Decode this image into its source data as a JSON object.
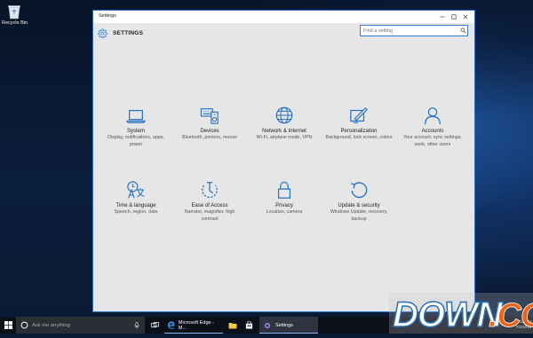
{
  "desktop": {
    "recycle_bin_label": "Recycle Bin"
  },
  "window": {
    "title": "Settings",
    "header_title": "SETTINGS",
    "search_placeholder": "Find a setting",
    "accent": "#0f6cbd"
  },
  "tiles": [
    {
      "name": "System",
      "desc": "Display, notifications, apps, power",
      "icon": "laptop-icon"
    },
    {
      "name": "Devices",
      "desc": "Bluetooth, printers, mouse",
      "icon": "keyboard-speaker-icon"
    },
    {
      "name": "Network & Internet",
      "desc": "Wi-Fi, airplane mode, VPN",
      "icon": "globe-icon"
    },
    {
      "name": "Personalization",
      "desc": "Background, lock screen, colors",
      "icon": "paint-icon"
    },
    {
      "name": "Accounts",
      "desc": "Your account, sync settings, work, other users",
      "icon": "person-icon"
    },
    {
      "name": "Time & language",
      "desc": "Speech, region, date",
      "icon": "clock-language-icon"
    },
    {
      "name": "Ease of Access",
      "desc": "Narrator, magnifier, high contrast",
      "icon": "ease-icon"
    },
    {
      "name": "Privacy",
      "desc": "Location, camera",
      "icon": "lock-icon"
    },
    {
      "name": "Update & security",
      "desc": "Windows Update, recovery, backup",
      "icon": "refresh-icon"
    }
  ],
  "taskbar": {
    "search_placeholder": "Ask me anything",
    "apps": [
      {
        "label": "Microsoft Edge - M..."
      },
      {
        "label": "Settings"
      }
    ],
    "clock_time": "1:12 PM",
    "clock_date": "7/8/2015"
  },
  "watermark": {
    "text": "DOWN.CC"
  }
}
